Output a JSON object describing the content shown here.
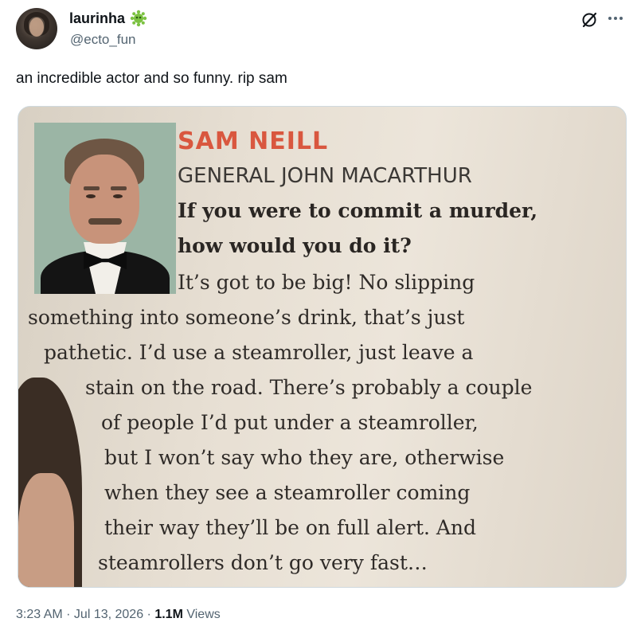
{
  "user": {
    "display_name": "laurinha",
    "handle": "@ecto_fun",
    "badge_icon": "slime-badge-icon"
  },
  "header_icons": [
    "grok-icon",
    "more-icon"
  ],
  "tweet": {
    "text": "an incredible actor and so funny. rip sam"
  },
  "media": {
    "name": "SAM NEILL",
    "role": "GENERAL JOHN MACARTHUR",
    "question_lines": [
      "If you were to commit a murder,",
      "how would you do it?"
    ],
    "answer_lines": [
      "It’s got to be big! No slipping",
      "something into someone’s drink, that’s just",
      "pathetic. I’d use a steamroller, just leave a",
      "stain on the road. There’s probably a couple",
      "of people I’d put under a steamroller,",
      "but I won’t say who they are, otherwise",
      "when they see a steamroller coming",
      "their way they’ll be on full alert. And",
      "steamrollers don’t go very fast…"
    ]
  },
  "meta": {
    "time": "3:23 AM",
    "separator": " · ",
    "date": "Jul 13, 2026",
    "views_count": "1.1M",
    "views_label": " Views"
  },
  "colors": {
    "name_accent": "#d9573f",
    "secondary_text": "#536471",
    "badge_green": "#7cc242"
  }
}
